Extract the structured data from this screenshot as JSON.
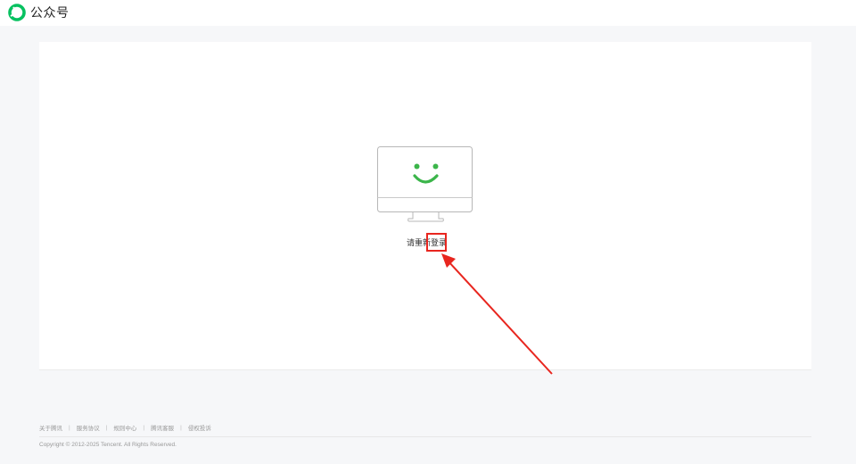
{
  "header": {
    "brand_name": "公众号",
    "logo_icon": "wechat-official-account-logo",
    "brand_color": "#07c160"
  },
  "main": {
    "message_prefix": "请重新",
    "login_link": "登录",
    "illustration_icon": "smiling-monitor-icon",
    "smile_color": "#3bb54a"
  },
  "annotation": {
    "color": "#e8261f"
  },
  "footer": {
    "links": [
      "关于腾讯",
      "服务协议",
      "规则中心",
      "腾讯客服",
      "侵权投诉"
    ],
    "separator": "|",
    "copyright": "Copyright © 2012-2025 Tencent. All Rights Reserved."
  }
}
